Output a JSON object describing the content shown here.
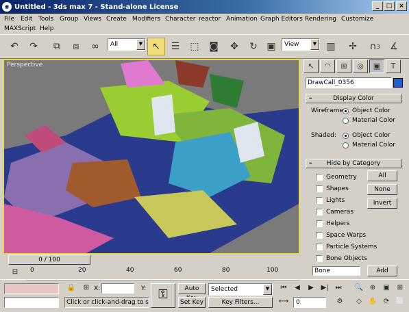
{
  "window": {
    "title": "Untitled - 3ds max 7 - Stand-alone License",
    "min_glyph": "_",
    "max_glyph": "□",
    "close_glyph": "×"
  },
  "menu": {
    "row1": [
      "File",
      "Edit",
      "Tools",
      "Group",
      "Views",
      "Create",
      "Modifiers",
      "Character",
      "reactor",
      "Animation",
      "Graph Editors",
      "Rendering",
      "Customize"
    ],
    "row2": [
      "MAXScript",
      "Help"
    ]
  },
  "toolbar": {
    "selection_filter": "All",
    "reference_coord": "View",
    "icons": [
      "undo-icon",
      "redo-icon",
      "select-and-link-icon",
      "unlink-icon",
      "bind-space-warp-icon",
      "select-object-icon",
      "select-by-name-icon",
      "rectangular-selection-icon",
      "window-crossing-icon",
      "select-and-move-icon",
      "select-and-rotate-icon",
      "select-and-scale-icon",
      "use-pivot-center-icon",
      "manipulate-icon",
      "snap-toggle-icon",
      "angle-snap-icon"
    ],
    "snap_label": "3"
  },
  "viewport": {
    "label": "Perspective"
  },
  "command_panel": {
    "tabs": [
      "create-tab-icon",
      "modify-tab-icon",
      "hierarchy-tab-icon",
      "motion-tab-icon",
      "display-tab-icon",
      "utilities-tab-icon"
    ],
    "object_name": "DrawCall_0356",
    "object_color": "#1f5fcf",
    "display_color": {
      "title": "Display Color",
      "wireframe_label": "Wireframe:",
      "shaded_label": "Shaded:",
      "object_color": "Object Color",
      "material_color": "Material Color"
    },
    "hide_by_category": {
      "title": "Hide by Category",
      "categories": [
        "Geometry",
        "Shapes",
        "Lights",
        "Cameras",
        "Helpers",
        "Space Warps",
        "Particle Systems",
        "Bone Objects"
      ],
      "all_button": "All",
      "none_button": "None",
      "invert_button": "Invert",
      "bone_field": "Bone",
      "add_button": "Add"
    }
  },
  "timeline": {
    "frame_counter": "0 / 100",
    "ticks": [
      "0",
      "20",
      "40",
      "60",
      "80",
      "100"
    ]
  },
  "status": {
    "x_label": "X:",
    "y_label": "Y:",
    "prompt": "Click or click-and-drag to select",
    "auto_key": "Auto Key",
    "set_key": "Set Key",
    "selected": "Selected",
    "key_filters": "Key Filters...",
    "current_frame": "0"
  }
}
